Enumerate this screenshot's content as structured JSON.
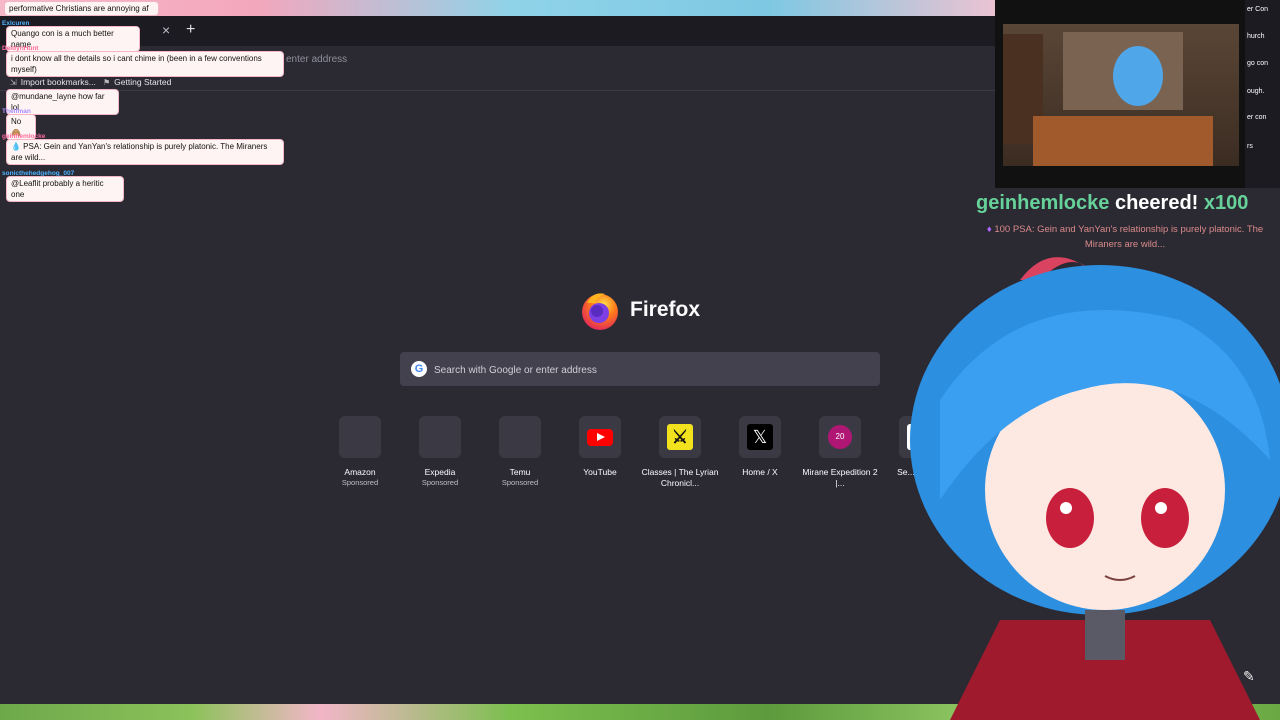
{
  "browser": {
    "brand": "Firefox",
    "tab_close": "×",
    "new_tab": "+",
    "urlbar_hint": "enter address",
    "bookmarks": [
      {
        "label": "Import bookmarks..."
      },
      {
        "label": "Getting Started"
      }
    ]
  },
  "newtab": {
    "search_placeholder": "Search with Google or enter address",
    "tiles": [
      {
        "label": "Amazon",
        "sub": "Sponsored"
      },
      {
        "label": "Expedia",
        "sub": "Sponsored"
      },
      {
        "label": "Temu",
        "sub": "Sponsored"
      },
      {
        "label": "YouTube",
        "sub": ""
      },
      {
        "label": "Classes | The Lyrian Chronicl...",
        "sub": ""
      },
      {
        "label": "Home / X",
        "sub": ""
      },
      {
        "label": "Mirane Expedition 2 |...",
        "sub": "",
        "badge": "20"
      },
      {
        "label": "Se... Anim...",
        "sub": ""
      }
    ]
  },
  "chat": {
    "messages": [
      {
        "user": "",
        "text": "performative Christians are annoying af"
      },
      {
        "user": "Exlcuren",
        "text": "Quango con is a much better name"
      },
      {
        "user": "DeldynHunt",
        "text": "i dont know all the details so i cant chime in (been in a few conventions myself)"
      },
      {
        "user": "",
        "text": "@mundane_layne how far lol"
      },
      {
        "user": "Thelfman",
        "text": "No 🙈"
      },
      {
        "user": "geinhemlocke",
        "text": "💧 PSA: Gein and YanYan's relationship is purely platonic. The Miraners are wild..."
      },
      {
        "user": "sonicthehedgehog_007",
        "text": "@Leaflit probably a heritic one"
      }
    ],
    "side_snippets": [
      "er Con",
      "hurch",
      "go con",
      "ough.",
      "er con",
      "rs"
    ]
  },
  "cheer": {
    "user": "geinhemlocke",
    "verb": "cheered!",
    "amount": "x100",
    "bits": "100",
    "message": "PSA: Gein and YanYan's relationship is purely platonic. The Miraners are wild..."
  },
  "colors": {
    "browser_bg": "#2b2a33",
    "chrome_bg": "#1c1b22",
    "search_bg": "#42414d",
    "cheer_green": "#66d29a"
  }
}
